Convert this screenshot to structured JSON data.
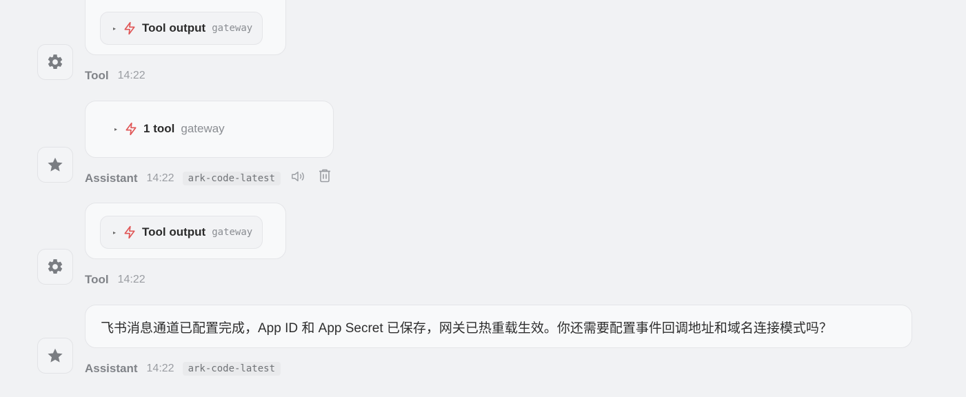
{
  "messages": [
    {
      "role": "Tool",
      "time": "14:22",
      "tool": {
        "label": "Tool output",
        "tag": "gateway"
      }
    },
    {
      "role": "Assistant",
      "time": "14:22",
      "model": "ark-code-latest",
      "tool": {
        "label": "1 tool",
        "tag": "gateway"
      },
      "actions": [
        "speaker-icon",
        "trash-icon"
      ]
    },
    {
      "role": "Tool",
      "time": "14:22",
      "tool": {
        "label": "Tool output",
        "tag": "gateway"
      }
    },
    {
      "role": "Assistant",
      "time": "14:22",
      "model": "ark-code-latest",
      "text": "飞书消息通道已配置完成，App ID 和 App Secret 已保存，网关已热重载生效。你还需要配置事件回调地址和域名连接模式吗？"
    }
  ],
  "icons": {
    "tool_avatar": "gear-icon",
    "assistant_avatar": "star-icon",
    "tool_marker": "lightning-bolt-icon",
    "expand": "caret-right-icon"
  },
  "colors": {
    "background": "#f1f2f4",
    "bolt": "#e05555",
    "avatar_icon": "#7a7d82"
  }
}
